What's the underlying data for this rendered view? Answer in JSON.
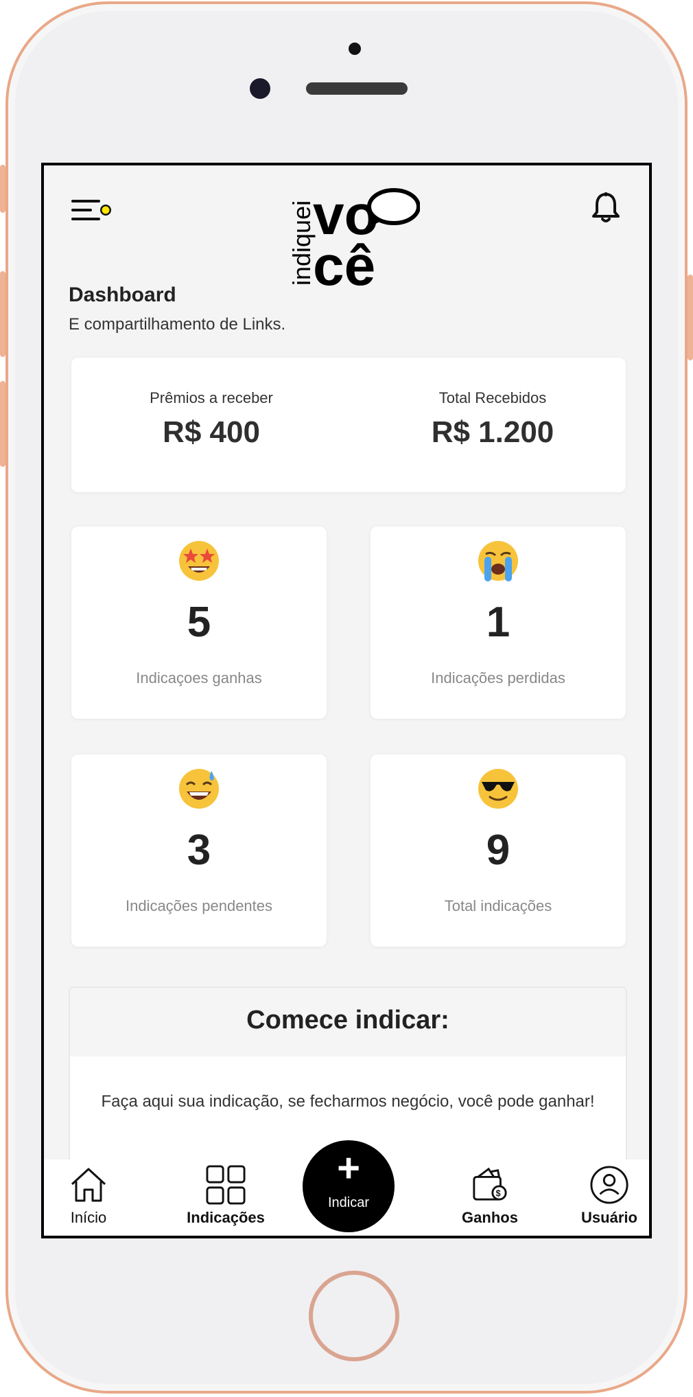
{
  "header": {
    "logo_text_small": "indiquei",
    "logo_text_top": "vo",
    "logo_text_bottom": "cê",
    "menu_icon": "menu-icon",
    "notification_icon": "bell-icon"
  },
  "page": {
    "title": "Dashboard",
    "subtitle": "E compartilhamento de Links."
  },
  "summary": {
    "pending_label": "Prêmios a receber",
    "pending_value": "R$ 400",
    "received_label": "Total Recebidos",
    "received_value": "R$ 1.200"
  },
  "stats": [
    {
      "emoji": "star-struck-emoji",
      "value": "5",
      "label": "Indicaçoes ganhas"
    },
    {
      "emoji": "crying-emoji",
      "value": "1",
      "label": "Indicações perdidas"
    },
    {
      "emoji": "sweat-smile-emoji",
      "value": "3",
      "label": "Indicações pendentes"
    },
    {
      "emoji": "sunglasses-emoji",
      "value": "9",
      "label": "Total indicações"
    }
  ],
  "cta": {
    "title": "Comece indicar:",
    "text": "Faça aqui sua indicação, se fecharmos negócio, você pode ganhar!"
  },
  "nav": {
    "home": "Início",
    "referrals": "Indicações",
    "fab": "Indicar",
    "earnings": "Ganhos",
    "user": "Usuário"
  },
  "colors": {
    "accent": "#000000",
    "notification_dot": "#ffe600",
    "frame": "#e9a888"
  }
}
